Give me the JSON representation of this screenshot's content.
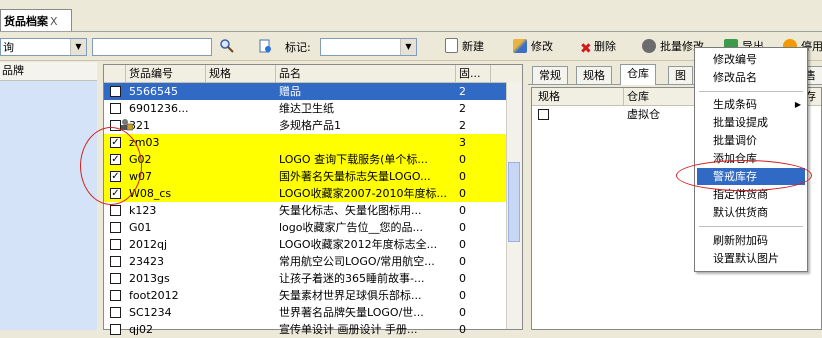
{
  "tab": {
    "title": "货品档案",
    "close": "X"
  },
  "toolbar": {
    "combo1_value": "询",
    "combo_arrow": "▼",
    "mark_label": "标记:",
    "new_label": "新建",
    "edit_label": "修改",
    "delete_label": "删除",
    "batch_edit_label": "批量修改",
    "export_label": "导出",
    "disable_label": "停用"
  },
  "left": {
    "header": "品牌"
  },
  "grid": {
    "headers": [
      "货品编号",
      "规格",
      "品名",
      "固..."
    ],
    "rows": [
      {
        "checked": false,
        "code": "5566545",
        "spec": "",
        "name": "赠品",
        "qty": "2"
      },
      {
        "checked": false,
        "code": "6901236...",
        "spec": "",
        "name": "维达卫生纸",
        "qty": "2"
      },
      {
        "checked": false,
        "code": "321",
        "spec": "",
        "name": "多规格产品1",
        "qty": "2"
      },
      {
        "checked": true,
        "code": "zm03",
        "spec": "",
        "name": "",
        "qty": "3"
      },
      {
        "checked": true,
        "code": "G02",
        "spec": "",
        "name": "LOGO 查询下载服务(单个标...",
        "qty": "0"
      },
      {
        "checked": true,
        "code": "w07",
        "spec": "",
        "name": "国外著名矢量标志矢量LOGO...",
        "qty": "0"
      },
      {
        "checked": true,
        "code": "W08_cs",
        "spec": "",
        "name": "LOGO收藏家2007-2010年度标...",
        "qty": "0"
      },
      {
        "checked": false,
        "code": "k123",
        "spec": "",
        "name": "矢量化标志、矢量化图标用...",
        "qty": "0"
      },
      {
        "checked": false,
        "code": "G01",
        "spec": "",
        "name": "logo收藏家广告位__您的品...",
        "qty": "0"
      },
      {
        "checked": false,
        "code": "2012qj",
        "spec": "",
        "name": "LOGO收藏家2012年度标志全...",
        "qty": "0"
      },
      {
        "checked": false,
        "code": "23423",
        "spec": "",
        "name": "常用航空公司LOGO/常用航空...",
        "qty": "0"
      },
      {
        "checked": false,
        "code": "2013gs",
        "spec": "",
        "name": "让孩子着迷的365睡前故事-...",
        "qty": "0"
      },
      {
        "checked": false,
        "code": "foot2012",
        "spec": "",
        "name": "矢量素材世界足球俱乐部标...",
        "qty": "0"
      },
      {
        "checked": false,
        "code": "SC1234",
        "spec": "",
        "name": "世界著名品牌矢量LOGO/世...",
        "qty": "0"
      },
      {
        "checked": false,
        "code": "qj02",
        "spec": "",
        "name": "宣传单设计 画册设计 手册...",
        "qty": "0"
      }
    ]
  },
  "right": {
    "tabs": [
      "常规",
      "规格",
      "仓库",
      "图",
      "售"
    ],
    "headers": [
      "规格",
      "仓库",
      "存"
    ],
    "rows": [
      {
        "spec": "",
        "warehouse": "虚拟仓"
      }
    ]
  },
  "menu": {
    "items": [
      "修改编号",
      "修改品名",
      "生成条码",
      "批量设提成",
      "批量调价",
      "添加仓库",
      "警戒库存",
      "指定供货商",
      "默认供货商",
      "刷新附加码",
      "设置默认图片"
    ],
    "submenu_arrow": "▶"
  },
  "colors": {
    "selected_row": "#316ac5",
    "highlight_rows": "#ffff00",
    "annotation": "#d42020"
  }
}
